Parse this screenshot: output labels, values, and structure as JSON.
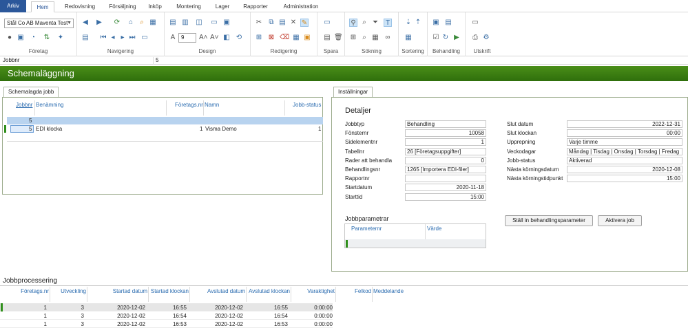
{
  "menu": {
    "tabs": [
      "Arkiv",
      "Hem",
      "Redovisning",
      "Försäljning",
      "Inköp",
      "Montering",
      "Lager",
      "Rapporter",
      "Administration"
    ]
  },
  "ribbon": {
    "company_value": "Stål Co AB Maventa Test",
    "font_size_value": "9",
    "groups": [
      "Företag",
      "Navigering",
      "Design",
      "Redigering",
      "Spara",
      "Sökning",
      "Sortering",
      "Behandling",
      "Utskrift"
    ]
  },
  "address": {
    "field_label": "Jobbnr",
    "field_value": "5"
  },
  "header": {
    "title": "Schemaläggning"
  },
  "scheduled": {
    "tab_label": "Schemalagda jobb",
    "columns": [
      "Jobbnr",
      "Benämning",
      "Företags.nr",
      "Namn",
      "Jobb-status"
    ],
    "filter_value": "5",
    "row": {
      "jobbnr": "5",
      "benamning": "EDI klocka",
      "foretagsnr": "1",
      "namn": "Visma Demo",
      "status": "1"
    }
  },
  "settings": {
    "tab_label": "Inställningar",
    "section_title": "Detaljer",
    "left": [
      {
        "label": "Jobbtyp",
        "value": "Behandling",
        "align": "l"
      },
      {
        "label": "Fönsternr",
        "value": "10058",
        "align": "r"
      },
      {
        "label": "Sidelementnr",
        "value": "1",
        "align": "r"
      },
      {
        "label": "Tabellnr",
        "value": "26 [Företagsuppgifter]",
        "align": "l"
      },
      {
        "label": "Rader att behandla",
        "value": "0",
        "align": "r"
      },
      {
        "label": "Behandlingsnr",
        "value": "1265 [Importera EDI-filer]",
        "align": "l"
      },
      {
        "label": "Rapportnr",
        "value": "",
        "align": "r"
      },
      {
        "label": "Startdatum",
        "value": "2020-11-18",
        "align": "r"
      },
      {
        "label": "Starttid",
        "value": "15:00",
        "align": "r"
      }
    ],
    "right": [
      {
        "label": "Slut datum",
        "value": "2022-12-31",
        "align": "r"
      },
      {
        "label": "Slut klockan",
        "value": "00:00",
        "align": "r"
      },
      {
        "label": "Upprepning",
        "value": "Varje timme",
        "align": "l"
      },
      {
        "label": "Veckodagar",
        "value": "Måndag | Tisdag | Onsdag | Torsdag | Fredag",
        "align": "l"
      },
      {
        "label": "Jobb-status",
        "value": "Aktiverad",
        "align": "l"
      },
      {
        "label": "Nästa körningsdatum",
        "value": "2020-12-08",
        "align": "r"
      },
      {
        "label": "Nästa körningstidpunkt",
        "value": "15:00",
        "align": "r"
      }
    ],
    "params_title": "Jobbparametrar",
    "params_columns": [
      "Parameternr",
      "Värde"
    ],
    "btn_params": "Ställ in behandlingsparameter",
    "btn_activate": "Aktivera job"
  },
  "processing": {
    "title": "Jobbprocessering",
    "columns": [
      "Företags.nr",
      "Utveckling",
      "Startad datum",
      "Startad klockan",
      "Avslutad datum",
      "Avslutad klockan",
      "Varaktighet",
      "Felkod",
      "Meddelande"
    ],
    "rows": [
      [
        "1",
        "3",
        "2020-12-02",
        "16:55",
        "2020-12-02",
        "16:55",
        "0:00:00",
        "",
        ""
      ],
      [
        "1",
        "3",
        "2020-12-02",
        "16:54",
        "2020-12-02",
        "16:54",
        "0:00:00",
        "",
        ""
      ],
      [
        "1",
        "3",
        "2020-12-02",
        "16:53",
        "2020-12-02",
        "16:53",
        "0:00:00",
        "",
        ""
      ]
    ]
  }
}
